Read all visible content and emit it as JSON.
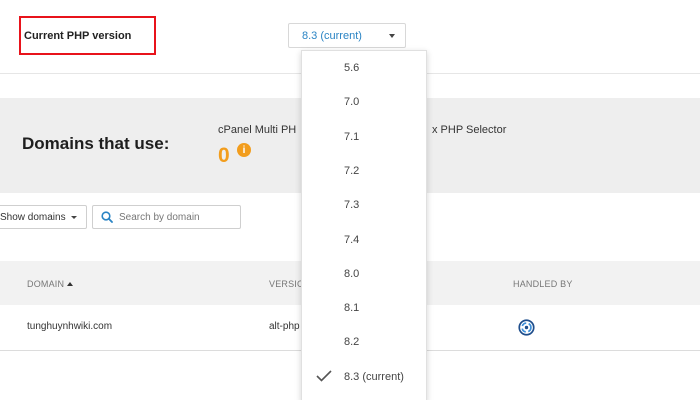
{
  "header": {
    "php_version_label": "Current PHP version",
    "selected_version": "8.3 (current)"
  },
  "summary": {
    "title": "Domains that use:",
    "col1_label": "cPanel Multi PH",
    "col2_label": "x PHP Selector",
    "count": "0",
    "info_glyph": "i"
  },
  "filters": {
    "show_domains_label": "Show domains",
    "search_placeholder": "Search by domain"
  },
  "table": {
    "headers": {
      "domain": "DOMAIN",
      "version": "VERSIO",
      "handled_by": "HANDLED BY"
    },
    "rows": [
      {
        "domain": "tunghuynhwiki.com",
        "version": "alt-php",
        "handled_by_icon": "cloudlinux-icon"
      }
    ]
  },
  "dropdown": {
    "options": [
      "5.6",
      "7.0",
      "7.1",
      "7.2",
      "7.3",
      "7.4",
      "8.0",
      "8.1",
      "8.2",
      "8.3 (current)"
    ],
    "checked": "8.3 (current)"
  },
  "colors": {
    "highlight_border": "#e8131b",
    "accent_blue": "#2a84c4",
    "count_orange": "#f29d1d"
  }
}
